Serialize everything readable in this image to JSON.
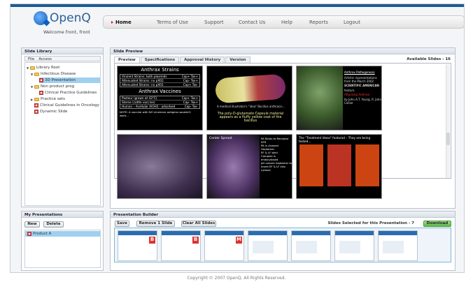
{
  "brand": {
    "name": "OpenQ",
    "welcome": "Welcome front, front"
  },
  "nav": {
    "items": [
      "Home",
      "Terms of Use",
      "Support",
      "Contact Us",
      "Help",
      "Reports",
      "Logout"
    ],
    "active": "Home"
  },
  "library": {
    "title": "Slide Library",
    "menu": [
      "File",
      "Access"
    ],
    "tree": [
      "Library Root",
      "Infectious Disease",
      "3D Presentation",
      "Non product prog",
      "Clinical Practice Guidelines",
      "Practice sets",
      "Clinical Guidelines in Oncology",
      "Dynamic Slide"
    ]
  },
  "preview": {
    "title": "Slide Preview",
    "tabs": [
      "Preview",
      "Specifications",
      "Approval History",
      "Version"
    ],
    "available": "Available Slides - 16"
  },
  "slides": {
    "s1": {
      "title1": "Anthrax Strains",
      "rows1": [
        [
          "Virulent Strains: both plasmids",
          "Cap+ Tox+"
        ],
        [
          "Attenuated Strains: no pXO2",
          "Cap- Tox+"
        ],
        [
          "Attenuated Strains: no pXO1",
          "Cap+ Tox-"
        ]
      ],
      "title2": "Anthrax Vaccines",
      "rows2": [
        [
          "Pasteur (grown at 43°C)",
          "Cap+ Tox+"
        ],
        [
          "Sterne (cattle vaccine)",
          "Cap- Tox+"
        ],
        [
          "Human – Acellular AlOH3 - adsorbed",
          "Cap- Tox-"
        ]
      ],
      "note": "NOTE: A vaccine with NO virulence antigens wouldn't work..."
    },
    "s2": {
      "caption1": "A medical illustrator's \"idea\" Bacillus anthracis…",
      "caption2": "The poly-D-glutamate Capsule material appears as a fluffy yellow coat of the bacillus"
    },
    "s3": {
      "title": "Anthrax Pathogenesis",
      "sub": "Artistic representations from the March 2002",
      "mag": "SCIENTIFIC AMERICAN",
      "feat": "feature",
      "story": "Attacking Anthrax",
      "by": "by John A.T. Young, R. John Collier"
    },
    "s5": {
      "label": "Center Spread"
    },
    "s6": {
      "steps": [
        "PA Binds to Receptor ATR",
        "PA is cleaved",
        "Heptamer",
        "EF & LF bind",
        "Complex is endocytosed",
        "pH causes heptamer to insert EF & LF into cytosol"
      ]
    },
    "s7": {
      "title": "The \"Treatment Ideas\" featured – They are being tested…"
    }
  },
  "my": {
    "title": "My Presentations",
    "new": "New",
    "delete": "Delete",
    "items": [
      "Product A"
    ]
  },
  "builder": {
    "title": "Presentation Builder",
    "save": "Save",
    "remove": "Remove 1 Slide",
    "clear": "Clear All Slides",
    "selected": "Slides Selected for this Presentation - 7",
    "download": "Download",
    "badges": [
      "B",
      "B",
      "M",
      "",
      "",
      "",
      ""
    ]
  },
  "footer": "Copyright © 2007 OpenQ. All Rights Reserved."
}
